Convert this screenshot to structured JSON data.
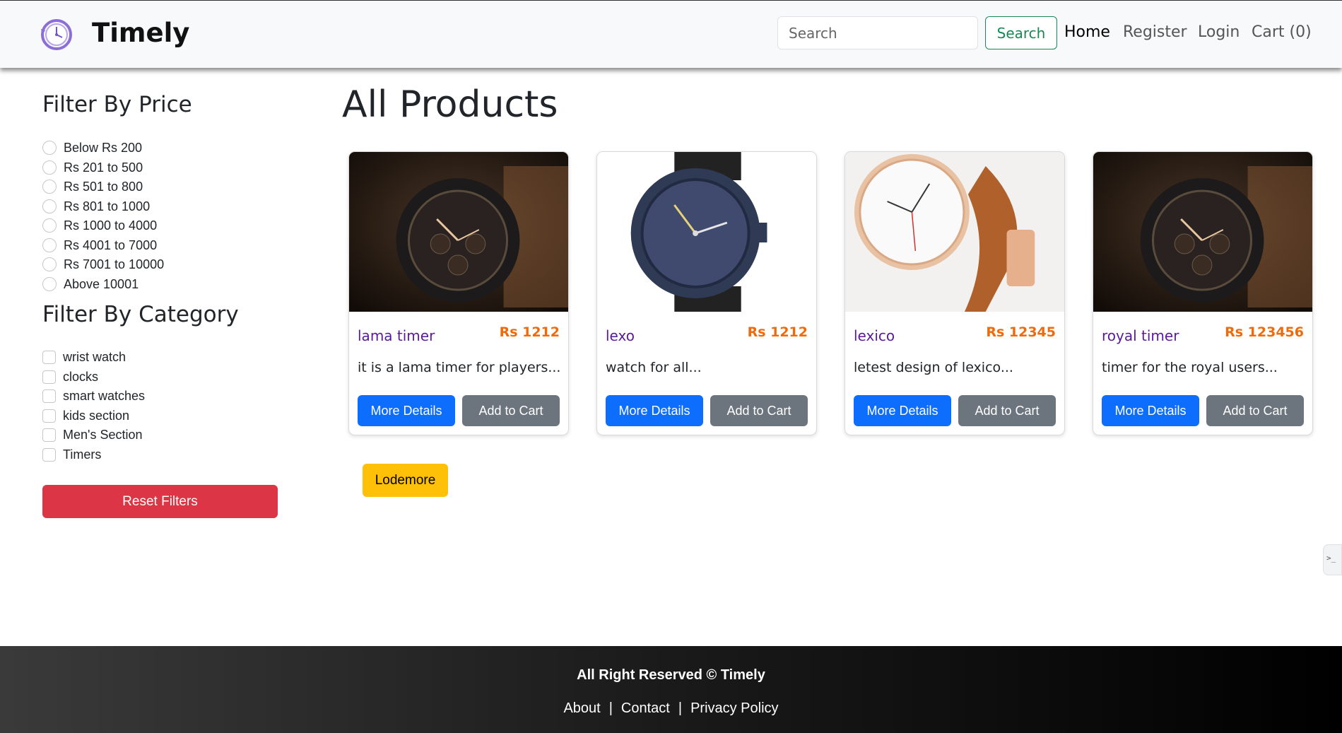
{
  "navbar": {
    "brand": "Timely",
    "search": {
      "placeholder": "Search",
      "button_label": "Search"
    },
    "links": {
      "home": "Home",
      "register": "Register",
      "login": "Login",
      "cart": "Cart (0)"
    }
  },
  "sidebar": {
    "price_title": "Filter By Price",
    "price_options": [
      "Below Rs 200",
      "Rs 201 to 500",
      "Rs 501 to 800",
      "Rs 801 to 1000",
      "Rs 1000 to 4000",
      "Rs 4001 to 7000",
      "Rs 7001 to 10000",
      "Above 10001"
    ],
    "category_title": "Filter By Category",
    "category_options": [
      "wrist watch",
      "clocks",
      "smart watches",
      "kids section",
      "Men's Section",
      "Timers"
    ],
    "reset_label": "Reset Filters"
  },
  "main": {
    "title": "All Products",
    "products": [
      {
        "name": "lama timer",
        "price": "Rs 1212",
        "description": "it is a lama timer for players...",
        "details_label": "More Details",
        "cart_label": "Add to Cart"
      },
      {
        "name": "lexo",
        "price": "Rs 1212",
        "description": "watch for all...",
        "details_label": "More Details",
        "cart_label": "Add to Cart"
      },
      {
        "name": "lexico",
        "price": "Rs 12345",
        "description": "letest design of lexico...",
        "details_label": "More Details",
        "cart_label": "Add to Cart"
      },
      {
        "name": "royal timer",
        "price": "Rs 123456",
        "description": "timer for the royal users...",
        "details_label": "More Details",
        "cart_label": "Add to Cart"
      }
    ],
    "load_more_label": "Lodemore"
  },
  "footer": {
    "copyright": "All Right Reserved © Timely",
    "links": [
      "About",
      "Contact",
      "Privacy Policy"
    ],
    "separator": "|"
  },
  "colors": {
    "primary": "#0d6efd",
    "secondary": "#6c757d",
    "danger": "#dc3545",
    "warning": "#ffc107",
    "success": "#198754",
    "price": "#f06a0a",
    "product_name": "#5a1a9c"
  }
}
